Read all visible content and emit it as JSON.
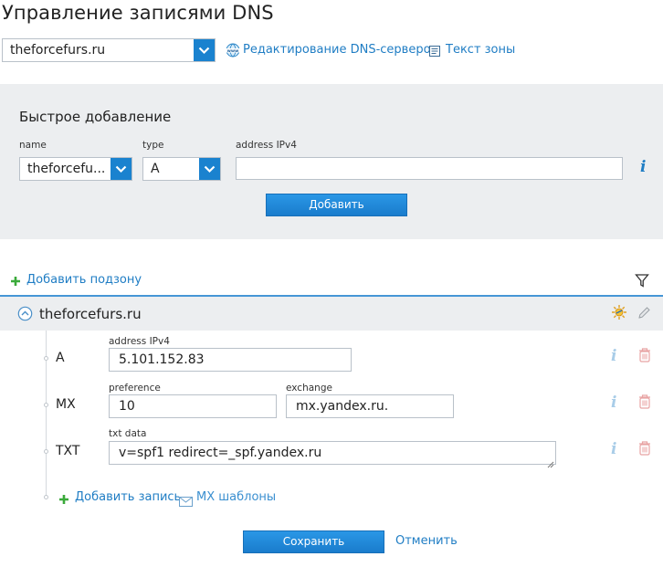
{
  "page": {
    "title": "Управление записями DNS"
  },
  "top_bar": {
    "domain_select_value": "theforcefurs.ru",
    "edit_dns_servers_label": "Редактирование DNS-серверов",
    "zone_text_label": "Текст зоны"
  },
  "quick_add": {
    "title": "Быстрое добавление",
    "name_label": "name",
    "name_value": "theforcefu...",
    "type_label": "type",
    "type_value": "A",
    "address_label": "address IPv4",
    "address_value": "",
    "add_button": "Добавить"
  },
  "subzone": {
    "add_label": "Добавить подзону"
  },
  "zone": {
    "name": "theforcefurs.ru",
    "records": [
      {
        "type": "A",
        "fields": [
          {
            "label": "address IPv4",
            "value": "5.101.152.83"
          }
        ]
      },
      {
        "type": "MX",
        "fields": [
          {
            "label": "preference",
            "value": "10"
          },
          {
            "label": "exchange",
            "value": "mx.yandex.ru."
          }
        ]
      },
      {
        "type": "TXT",
        "fields": [
          {
            "label": "txt data",
            "value": "v=spf1 redirect=_spf.yandex.ru"
          }
        ]
      }
    ],
    "add_record_label": "Добавить запись",
    "mx_templates_label": "MX шаблоны"
  },
  "actions": {
    "save_button": "Сохранить",
    "cancel_link": "Отменить"
  },
  "icons": {
    "info": "i",
    "accent": "#1a82cf",
    "delete": "#e8a3a3"
  }
}
